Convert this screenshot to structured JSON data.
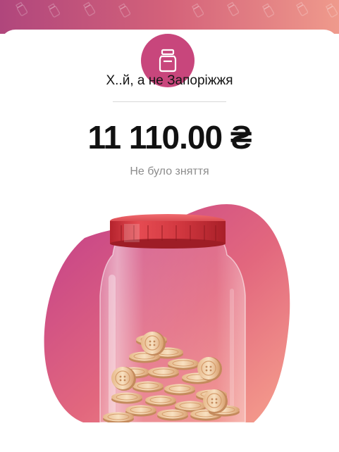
{
  "jar": {
    "title": "Х..й, а не Запоріжжя",
    "balance": "11 110.00 ₴",
    "withdrawal_status": "Не було зняття"
  },
  "icons": {
    "header": "jar-icon",
    "illustration": "coin-jar-illustration"
  },
  "colors": {
    "accent": "#c8467c",
    "gradient_start": "#b0467c",
    "gradient_end": "#ef9a8c",
    "lid": "#d63a44"
  }
}
